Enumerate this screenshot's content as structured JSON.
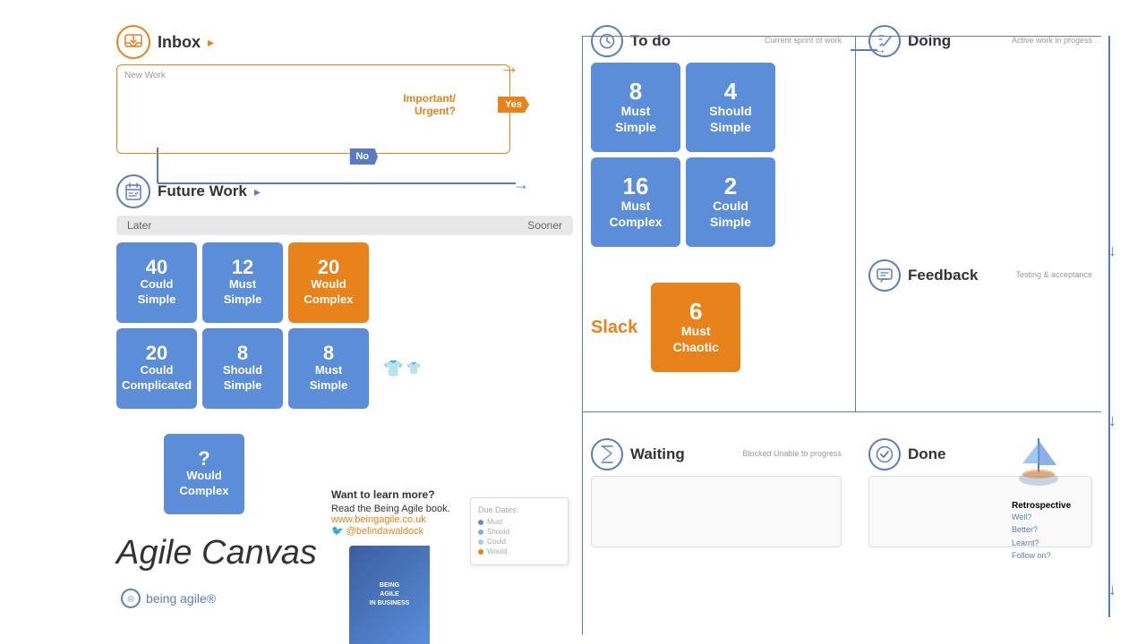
{
  "inbox": {
    "title": "Inbox",
    "arrow": "▸",
    "new_work_label": "New Work",
    "important_urgent": "Important/\nUrgent?",
    "yes_label": "Yes",
    "no_label": "No"
  },
  "future_work": {
    "title": "Future Work",
    "arrow": "▸",
    "later_label": "Later",
    "sooner_label": "Sooner",
    "cards": [
      {
        "number": "40",
        "line1": "Could",
        "line2": "Simple",
        "type": "blue"
      },
      {
        "number": "12",
        "line1": "Must",
        "line2": "Simple",
        "type": "blue"
      },
      {
        "number": "20",
        "line1": "Would",
        "line2": "Complex",
        "type": "orange"
      },
      {
        "number": "20",
        "line1": "Could",
        "line2": "Complicated",
        "type": "blue"
      },
      {
        "number": "8",
        "line1": "Should",
        "line2": "Simple",
        "type": "blue"
      },
      {
        "number": "8",
        "line1": "Must",
        "line2": "Simple",
        "type": "blue"
      }
    ],
    "bottom_card": {
      "number": "?",
      "line1": "Would",
      "line2": "Complex",
      "type": "blue"
    },
    "due_dates_title": "Due Dates:",
    "legend_items": [
      {
        "label": "Must",
        "color": "#5b8dd9"
      },
      {
        "label": "Should",
        "color": "#7ab0e8"
      },
      {
        "label": "Could",
        "color": "#a8caf0"
      },
      {
        "label": "Would",
        "color": "#e8821a"
      }
    ]
  },
  "to_do": {
    "title": "To do",
    "subtitle": "Current sprint of work",
    "cards": [
      {
        "number": "8",
        "line1": "Must",
        "line2": "Simple",
        "type": "blue"
      },
      {
        "number": "4",
        "line1": "Should",
        "line2": "Simple",
        "type": "blue"
      },
      {
        "number": "16",
        "line1": "Must",
        "line2": "Complex",
        "type": "blue"
      },
      {
        "number": "2",
        "line1": "Could",
        "line2": "Simple",
        "type": "blue"
      }
    ],
    "slack_label": "Slack",
    "slack_card": {
      "number": "6",
      "line1": "Must",
      "line2": "Chaotic",
      "type": "orange"
    }
  },
  "doing": {
    "title": "Doing",
    "subtitle": "Active work\nin progess"
  },
  "feedback": {
    "title": "Feedback",
    "subtitle": "Testing &\nacceptance"
  },
  "waiting": {
    "title": "Waiting",
    "subtitle": "Blocked\nUnable to progress"
  },
  "done": {
    "title": "Done"
  },
  "retrospective": {
    "title": "Retrospective",
    "items": [
      "Well?",
      "Better?",
      "Learnt?",
      "Follow on?"
    ]
  },
  "agile_canvas": {
    "title": "Agile Canvas",
    "brand": "being agile®"
  },
  "learn_more": {
    "heading": "Want to learn more?",
    "text": "Read the Being Agile book.",
    "website": "www.beingagile.co.uk",
    "twitter": "@belindawaldock"
  },
  "book": {
    "title": "BEING\nAGILE\nIN BUSINESS"
  },
  "icons": {
    "inbox": "📥",
    "future_work": "📋",
    "clock": "⏱",
    "pencil": "✏",
    "chat": "💬",
    "hourglass": "⏳",
    "checkmark": "✓",
    "target": "◎"
  }
}
